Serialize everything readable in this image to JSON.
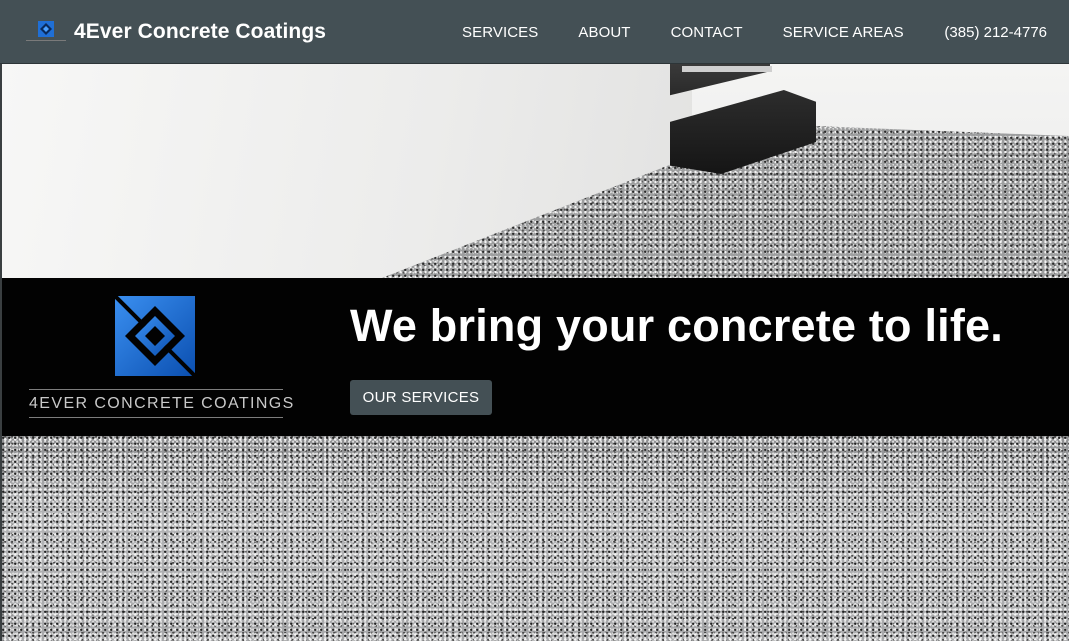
{
  "brand": {
    "title": "4Ever Concrete Coatings",
    "logo_icon": "diamond-tile-logo-icon"
  },
  "nav": {
    "links": [
      "SERVICES",
      "ABOUT",
      "CONTACT",
      "SERVICE AREAS"
    ],
    "phone": "(385) 212-4776"
  },
  "hero": {
    "tagline": "We bring your concrete to life.",
    "cta_label": "OUR SERVICES",
    "logo_text": "4EVER CONCRETE COATINGS"
  },
  "colors": {
    "navbar": "#445055",
    "band": "#020202",
    "logo_blue": "#1f6fd6"
  }
}
